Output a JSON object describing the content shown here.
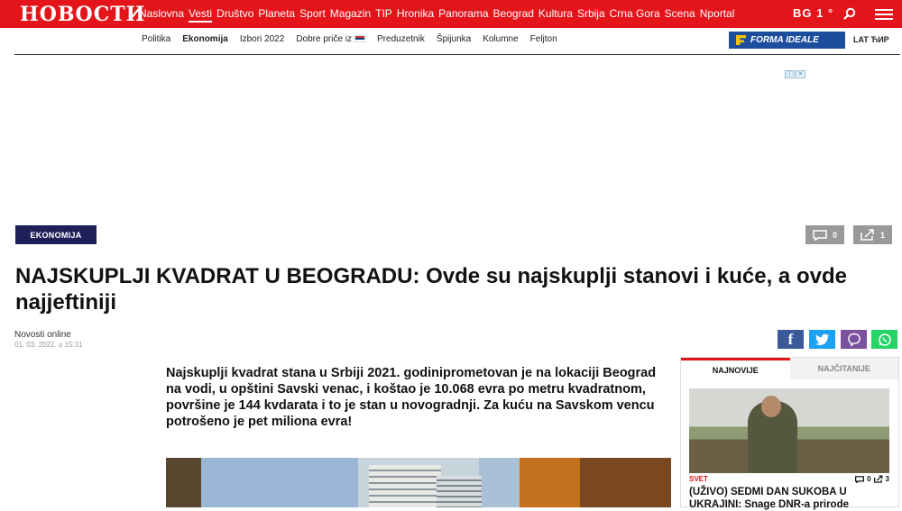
{
  "header": {
    "logo": "НОВОСТИ",
    "nav": [
      "Naslovna",
      "Vesti",
      "Društvo",
      "Planeta",
      "Sport",
      "Magazin",
      "TIP",
      "Hronika",
      "Panorama",
      "Beograd",
      "Kultura",
      "Srbija",
      "Crna Gora",
      "Scena",
      "Nportal"
    ],
    "active_nav": "Vesti",
    "weather": "BG 1 °",
    "search_icon": "search-icon",
    "menu_icon": "hamburger-menu-icon"
  },
  "subnav": {
    "items": [
      "Politika",
      "Ekonomija",
      "Izbori 2022",
      "Dobre priče iz",
      "Preduzetnik",
      "Špijunka",
      "Kolumne",
      "Feljton"
    ],
    "active": "Ekonomija",
    "brand": "FORMA IDEALE",
    "lang": "LAT ЋИР"
  },
  "article": {
    "category": "EKONOMIJA",
    "comments": "0",
    "shares": "1",
    "title": "NAJSKUPLJI KVADRAT U BEOGRADU: Ovde su najskuplji stanovi i kuće, a ovde najjeftiniji",
    "author": "Novosti online",
    "date": "01. 03. 2022. u 15:31",
    "lead": "Najskuplji kvadrat stana u Srbiji 2021. godiniprometovan je na lokaciji Beograd na vodi, u opštini Savski venac, i koštao je 10.068 evra po metru kvadratnom, površine je 144 kvdarata i to je stan u novogradnji. Za kuću na Savskom vencu potrošeno je pet miliona evra!",
    "share_buttons": [
      "facebook-icon",
      "twitter-icon",
      "viber-icon",
      "whatsapp-icon"
    ]
  },
  "sidebar": {
    "tabs": [
      "NAJNOVIJE",
      "NAJČITANIJE"
    ],
    "category": "SVET",
    "comments": "0",
    "shares": "3",
    "headline": "(UŽIVO) SEDMI DAN SUKOBA U UKRAJINI: Snage DNR-a prirode"
  },
  "colors": {
    "brand_red": "#e3151b",
    "category_bg": "#1f1f5a",
    "facebook": "#3b5998",
    "twitter": "#1da1f2",
    "viber": "#7b519d",
    "whatsapp": "#25d366"
  }
}
